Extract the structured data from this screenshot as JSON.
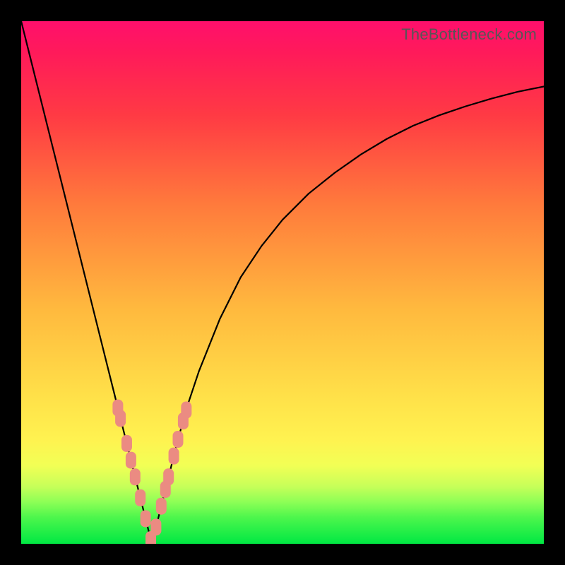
{
  "watermark": "TheBottleneck.com",
  "colors": {
    "frame": "#000000",
    "curve": "#000000",
    "marker_fill": "#eb8b82",
    "green": "#00e843",
    "yellow": "#ffe149",
    "orange": "#ff9a3a",
    "red": "#ff1f47",
    "magenta": "#ff0f6c"
  },
  "chart_data": {
    "type": "line",
    "title": "",
    "xlabel": "",
    "ylabel": "",
    "xlim": [
      0,
      100
    ],
    "ylim": [
      0,
      100
    ],
    "series": [
      {
        "name": "bottleneck-curve",
        "x": [
          0,
          2,
          4,
          6,
          8,
          10,
          12,
          14,
          16,
          18,
          20,
          21,
          22,
          23,
          24,
          25,
          26,
          27,
          28,
          30,
          32,
          34,
          38,
          42,
          46,
          50,
          55,
          60,
          65,
          70,
          75,
          80,
          85,
          90,
          95,
          100
        ],
        "y": [
          100,
          92,
          84,
          76,
          68,
          60,
          52,
          44,
          36,
          28,
          20,
          16,
          12,
          8,
          4,
          0,
          4,
          8,
          12,
          20,
          27,
          33,
          43,
          51,
          57,
          62,
          67,
          71,
          74.5,
          77.5,
          80,
          82,
          83.7,
          85.2,
          86.5,
          87.5
        ]
      }
    ],
    "markers": {
      "name": "highlighted-points",
      "x": [
        18.5,
        19.0,
        20.2,
        21.0,
        21.8,
        22.8,
        23.8,
        24.8,
        25.8,
        26.8,
        27.6,
        28.2,
        29.2,
        30.0,
        31.0,
        31.6
      ],
      "y": [
        26.0,
        24.0,
        19.2,
        16.0,
        12.8,
        8.8,
        4.8,
        0.8,
        3.2,
        7.2,
        10.4,
        12.8,
        16.8,
        20.0,
        23.5,
        25.6
      ]
    }
  }
}
